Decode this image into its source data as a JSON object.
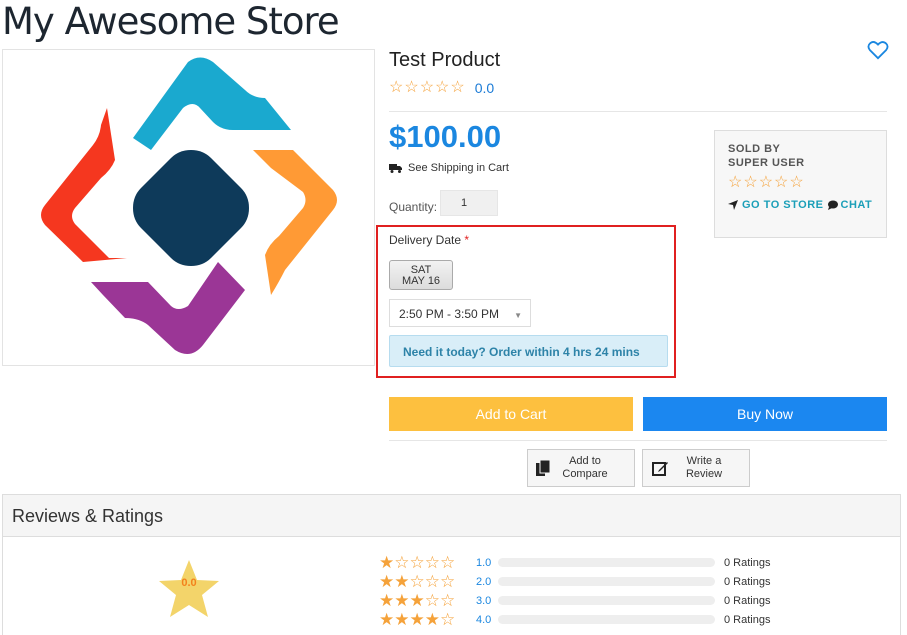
{
  "store": {
    "title": "My Awesome Store"
  },
  "product": {
    "name": "Test Product",
    "rating_value": "0.0",
    "price": "$100.00",
    "shipping_text": "See Shipping in Cart",
    "quantity_label": "Quantity:",
    "quantity_value": "1"
  },
  "seller": {
    "sold_by_label": "SOLD BY",
    "name": "SUPER USER",
    "go_to_store": "GO TO STORE",
    "chat": "CHAT"
  },
  "delivery": {
    "label": "Delivery Date",
    "required_mark": "*",
    "date_day": "SAT",
    "date_date": "MAY 16",
    "time_slot": "2:50 PM - 3:50 PM",
    "urgency_text": "Need it today? Order within 4 hrs 24 mins"
  },
  "actions": {
    "add_to_cart": "Add to Cart",
    "buy_now": "Buy Now",
    "add_compare_line1": "Add to",
    "add_compare_line2": "Compare",
    "write_review_line1": "Write a",
    "write_review_line2": "Review"
  },
  "reviews": {
    "title": "Reviews & Ratings",
    "average": "0.0",
    "rows": [
      {
        "stars": 1,
        "label": "1.0",
        "count": "0 Ratings"
      },
      {
        "stars": 2,
        "label": "2.0",
        "count": "0 Ratings"
      },
      {
        "stars": 3,
        "label": "3.0",
        "count": "0 Ratings"
      },
      {
        "stars": 4,
        "label": "4.0",
        "count": "0 Ratings"
      }
    ]
  },
  "colors": {
    "accent_blue": "#1b87e0",
    "star_orange": "#f5a23a",
    "add_cart_yellow": "#fdc03f",
    "highlight_red": "#e02020"
  },
  "icons": [
    "heart-icon",
    "star-icon",
    "truck-icon",
    "location-arrow-icon",
    "chat-bubble-icon",
    "compare-icon",
    "edit-icon",
    "chevron-down-icon"
  ]
}
